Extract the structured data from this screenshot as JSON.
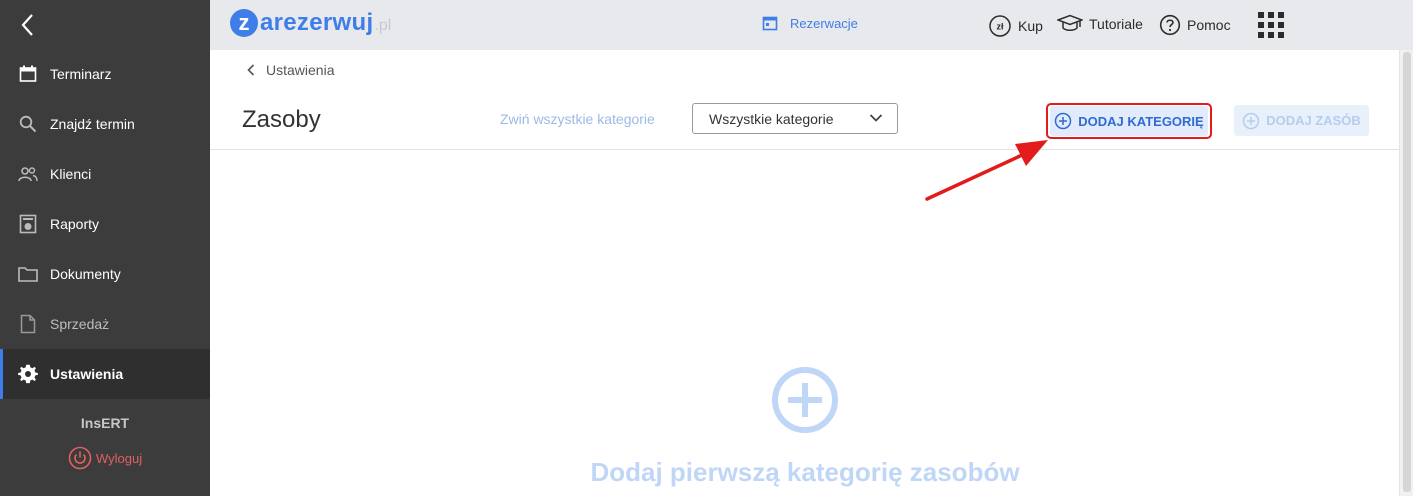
{
  "sidebar": {
    "items": [
      {
        "label": "Terminarz",
        "icon": "calendar-icon"
      },
      {
        "label": "Znajdź termin",
        "icon": "search-icon"
      },
      {
        "label": "Klienci",
        "icon": "people-icon"
      },
      {
        "label": "Raporty",
        "icon": "report-icon"
      },
      {
        "label": "Dokumenty",
        "icon": "folder-icon"
      },
      {
        "label": "Sprzedaż",
        "icon": "document-icon"
      },
      {
        "label": "Ustawienia",
        "icon": "gear-icon",
        "active": true
      }
    ],
    "org_name": "InsERT",
    "logout_label": "Wyloguj"
  },
  "topbar": {
    "logo_letter": "z",
    "logo_word": "arezerwuj",
    "logo_tld": ".pl",
    "nav_reservations": "Rezerwacje",
    "buy_label": "Kup",
    "buy_icon_text": "zł",
    "tutorials_label": "Tutoriale",
    "help_label": "Pomoc"
  },
  "main": {
    "breadcrumb": "Ustawienia",
    "title": "Zasoby",
    "collapse_all": "Zwiń wszystkie kategorie",
    "category_select_value": "Wszystkie kategorie",
    "add_category_label": "DODAJ KATEGORIĘ",
    "add_resource_label": "DODAJ ZASÓB",
    "empty_state_text": "Dodaj pierwszą kategorię zasobów"
  },
  "colors": {
    "accent": "#3f7ee8",
    "sidebar_bg": "#3c3c3c",
    "highlight": "#e21b1b",
    "logout": "#e06060"
  }
}
